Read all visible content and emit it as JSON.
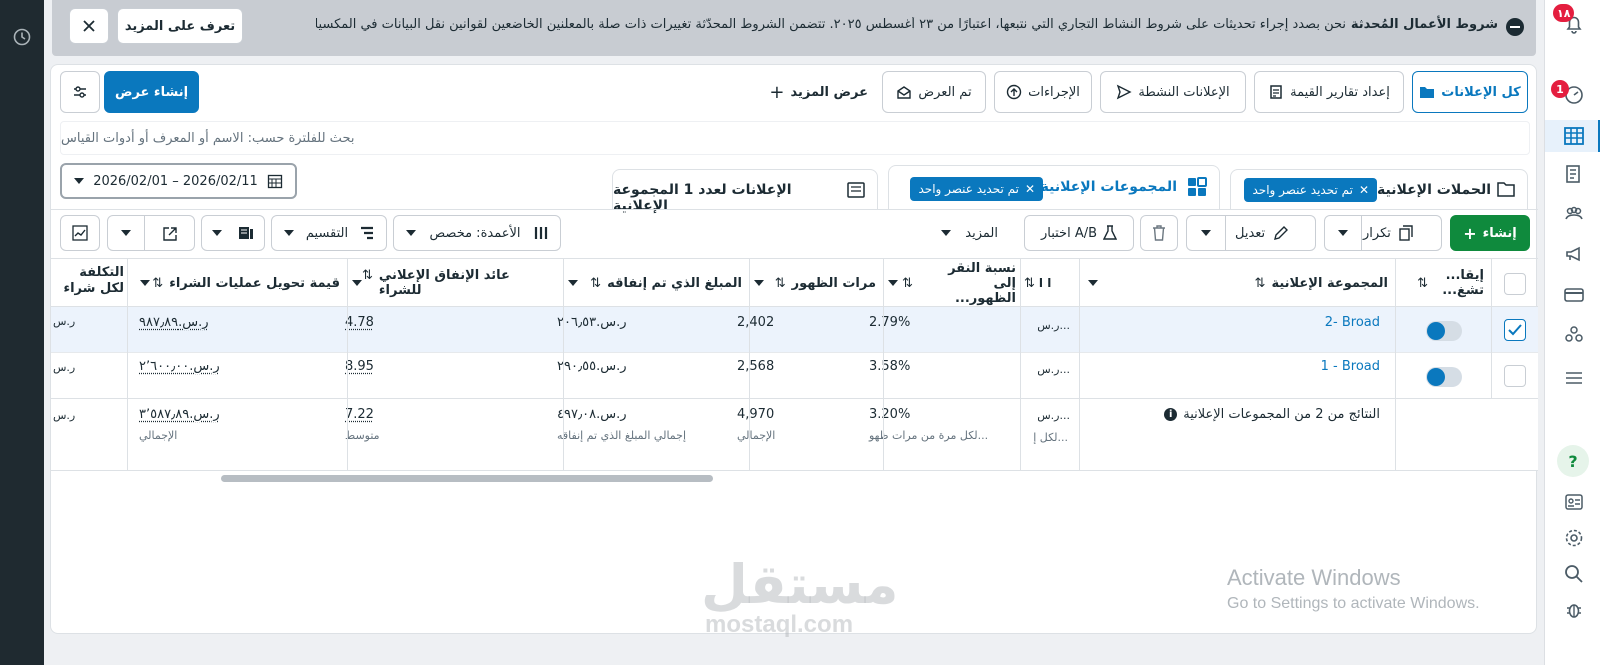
{
  "notice": {
    "title": "شروط الأعمال المُحدثة",
    "text": "نحن بصدد إجراء تحديثات على شروط النشاط التجاري التي نتبعها، اعتبارًا من ٢٣ أغسطس ٢٠٢٥. تتضمن الشروط المحدّثة تغييرات ذات صلة بالمعلنين الخاضعين لقوانين نقل البيانات في المكسيك وكنـ...",
    "learn_more": "تعرف على المزيد"
  },
  "right_nav": {
    "notifications_badge": "١٨",
    "alerts_badge": "1"
  },
  "top_tabs": {
    "all_ads": "كل الإعلانات",
    "value_reports": "إعداد تقارير القيمة",
    "active_ads": "الإعلانات النشطة",
    "actions": "الإجراءات",
    "displayed": "تم العرض",
    "show_more": "عرض المزيد",
    "create_view": "إنشاء عرض"
  },
  "search": {
    "placeholder": "بحث للفلترة حسب: الاسم أو المعرف أو أدوات القياس"
  },
  "level_tabs": {
    "campaigns": "الحملات الإعلانية",
    "campaigns_pill": "تم تحديد عنصر واحد",
    "adsets": "المجموعات الإعلانية",
    "adsets_pill": "تم تحديد عنصر واحد",
    "ads": "الإعلانات لعدد 1 المجموعة الإعلانية"
  },
  "date_range": "2026/02/01 – 2026/02/11",
  "toolbar": {
    "create": "إنشاء",
    "duplicate": "تكرار",
    "edit": "تعديل",
    "ab_test": "اختبار A/B",
    "more": "المزيد",
    "columns": "الأعمدة: مخصص",
    "breakdown": "التقسيم"
  },
  "table": {
    "headers": {
      "toggle": "إيقا... تشغ...",
      "adset": "المجموعة الإعلانية",
      "col_small": "ا ا",
      "ctr": "نسبة النقر إلى الظهور...",
      "impressions": "مرات الظهور",
      "spent": "المبلغ الذي تم إنفاقه",
      "roas": "عائد الإنفاق الإعلاني للشراء",
      "purchase_value": "قيمة تحويل عمليات الشراء",
      "cost_per_purchase": "التكلفة لكل شراء"
    },
    "rows": [
      {
        "name": "2- Broad",
        "small": "ر.س...",
        "ctr": "2.79%",
        "impressions": "2,402",
        "spent": "ر.س.٢٠٦٫٥٣",
        "roas": "4.78",
        "purchase_value": "ر.س.٩٨٧٫٨٩",
        "cost": "ر.س",
        "checked": true
      },
      {
        "name": "1 - Broad",
        "small": "ر.س...",
        "ctr": "3.58%",
        "impressions": "2,568",
        "spent": "ر.س.٢٩٠٫٥٥",
        "roas": "8.95",
        "purchase_value": "ر.س.٢٬٦٠٠٫٠٠",
        "cost": "ر.س",
        "checked": false
      }
    ],
    "summary": {
      "label": "النتائج من 2 من المجموعات الإعلانية",
      "small": "ر.س...",
      "small_sub": "لكل إ...",
      "ctr": "3.20%",
      "ctr_sub": "لكل مرة من مرات ظهو...",
      "impressions": "4,970",
      "impressions_sub": "الإجمالي",
      "spent": "ر.س.٤٩٧٫٠٨",
      "spent_sub": "إجمالي المبلغ الذي تم إنفاقه",
      "roas": "7.22",
      "roas_sub": "متوسط",
      "purchase_value": "ر.س.٣٬٥٨٧٫٨٩",
      "purchase_value_sub": "الإجمالي",
      "cost": "ر.س"
    }
  },
  "watermark": {
    "activate_title": "Activate Windows",
    "activate_sub": "Go to Settings to activate Windows.",
    "brand_ar": "مستقل",
    "brand_en": "mostaql.com"
  },
  "colors": {
    "primary_blue": "#0a78be",
    "green": "#0f8a3d",
    "sidebar_dark": "#1f2a30",
    "badge_red": "#e41e3f"
  }
}
